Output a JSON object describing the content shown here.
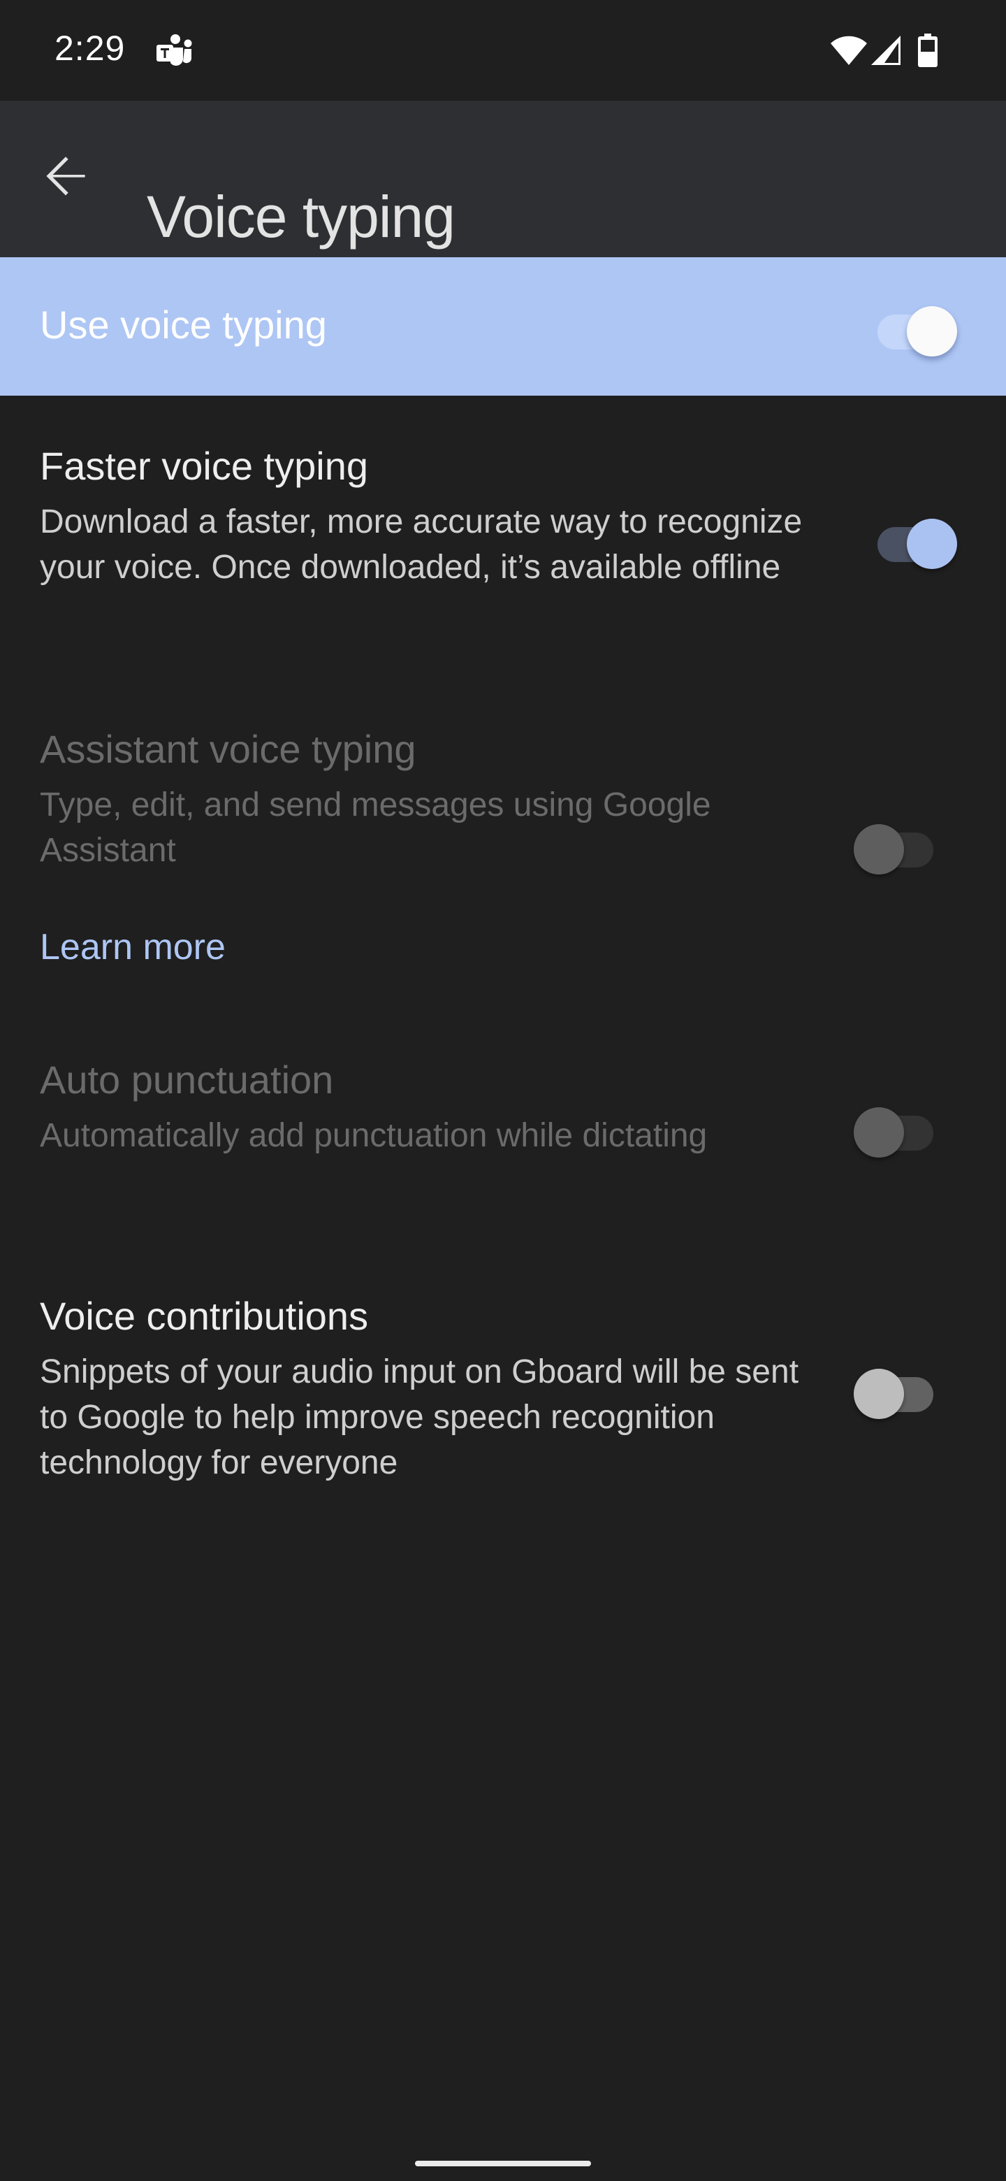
{
  "status_bar": {
    "time": "2:29",
    "notification_icons": [
      "teams-icon"
    ],
    "system_icons": [
      "wifi-icon",
      "signal-icon",
      "battery-icon"
    ]
  },
  "app_bar": {
    "back_icon": "arrow-back-icon",
    "title": "Voice typing"
  },
  "master_switch": {
    "label": "Use voice typing",
    "checked": true
  },
  "preferences": [
    {
      "title": "Faster voice typing",
      "description": "Download a faster, more accurate way to recognize your voice. Once downloaded, it’s available offline",
      "checked": true,
      "enabled": true
    },
    {
      "title": "Assistant voice typing",
      "description": "Type, edit, and send messages using Google Assistant",
      "checked": false,
      "enabled": false,
      "link": "Learn more"
    },
    {
      "title": "Auto punctuation",
      "description": "Automatically add punctuation while dictating",
      "checked": false,
      "enabled": false
    },
    {
      "title": "Voice contributions",
      "description": "Snippets of your audio input on Gboard will be sent to Google to help improve speech recognition technology for everyone",
      "checked": false,
      "enabled": true
    }
  ],
  "colors": {
    "accent": "#aec6f4",
    "background": "#1f1f1f",
    "app_bar": "#2e2f33"
  }
}
